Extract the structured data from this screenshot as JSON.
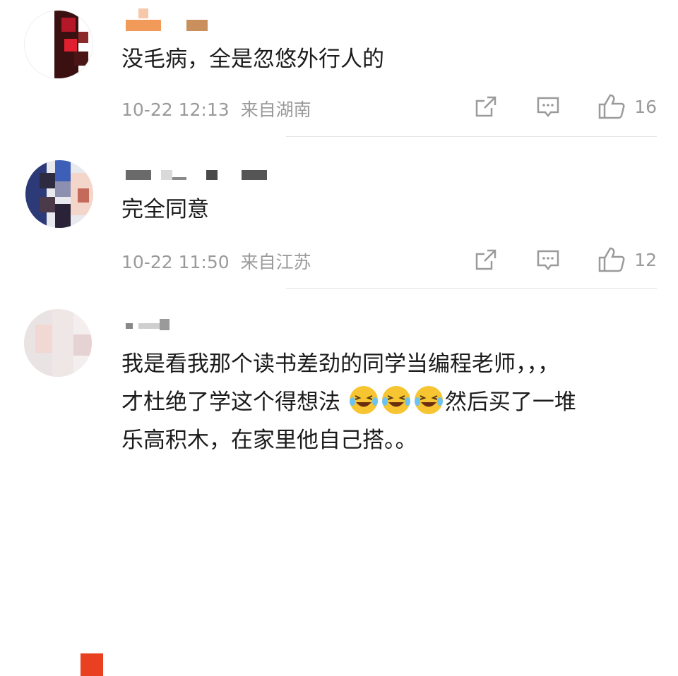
{
  "comments": [
    {
      "text": "没毛病，全是忽悠外行人的",
      "time": "10-22 12:13",
      "source": "来自湖南",
      "likes": "16",
      "icons": [
        "share-icon",
        "comment-icon",
        "thumb-up-icon"
      ]
    },
    {
      "text": "完全同意",
      "time": "10-22 11:50",
      "source": "来自江苏",
      "likes": "12",
      "icons": [
        "share-icon",
        "comment-icon",
        "thumb-up-icon"
      ]
    },
    {
      "lines": [
        "我是看我那个读书差劲的同学当编程老师，，，",
        "才杜绝了学这个得想法",
        "然后买了一堆",
        "乐高积木，在家里他自己搭。。"
      ],
      "emoji": "laughing-tears-emoji"
    }
  ],
  "colors": {
    "meta": "#9a9a9a",
    "text": "#1b1b1b",
    "divider": "#e6e6e6"
  }
}
